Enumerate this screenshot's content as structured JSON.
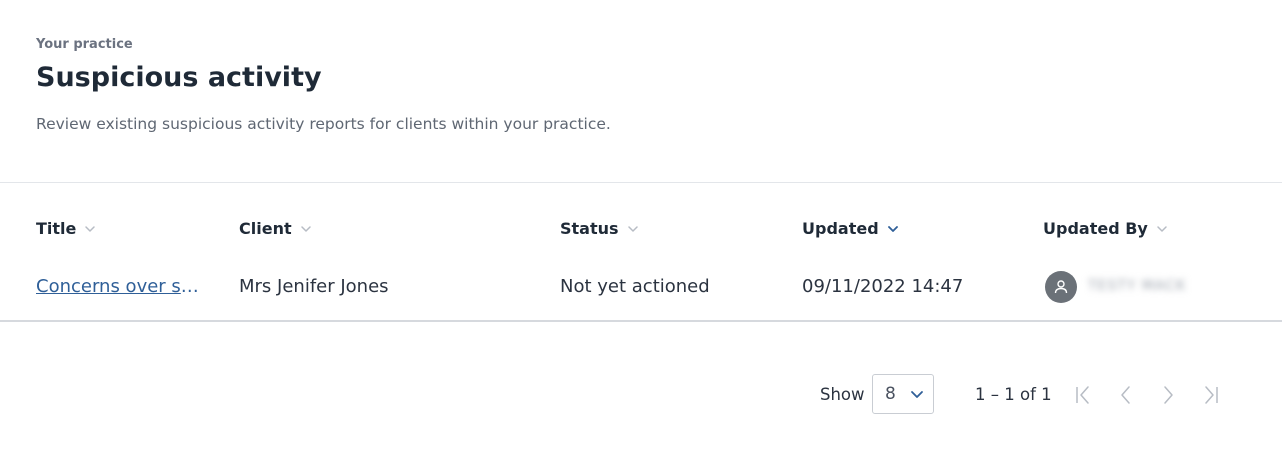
{
  "header": {
    "eyebrow": "Your practice",
    "title": "Suspicious activity",
    "description": "Review existing suspicious activity reports for clients within your practice."
  },
  "table": {
    "columns": [
      {
        "key": "title",
        "label": "Title",
        "sorted": false
      },
      {
        "key": "client",
        "label": "Client",
        "sorted": false
      },
      {
        "key": "status",
        "label": "Status",
        "sorted": false
      },
      {
        "key": "updated",
        "label": "Updated",
        "sorted": true
      },
      {
        "key": "updated_by",
        "label": "Updated By",
        "sorted": false
      }
    ],
    "rows": [
      {
        "title": "Concerns over so…",
        "client": "Mrs Jenifer Jones",
        "status": "Not yet actioned",
        "updated": "09/11/2022 14:47",
        "updated_by": "TESTY MACK"
      }
    ]
  },
  "pagination": {
    "show_label": "Show",
    "page_size": "8",
    "range_text": "1 – 1 of 1"
  },
  "colors": {
    "link": "#2f5f98",
    "sort_active": "#2f5f98",
    "sort_inactive": "#b7bcc4",
    "avatar_bg": "#6b7178"
  },
  "icons": {
    "sort": "chevron-down-icon",
    "avatar": "user-icon",
    "first": "first-page-icon",
    "prev": "chevron-left-icon",
    "next": "chevron-right-icon",
    "last": "last-page-icon"
  }
}
